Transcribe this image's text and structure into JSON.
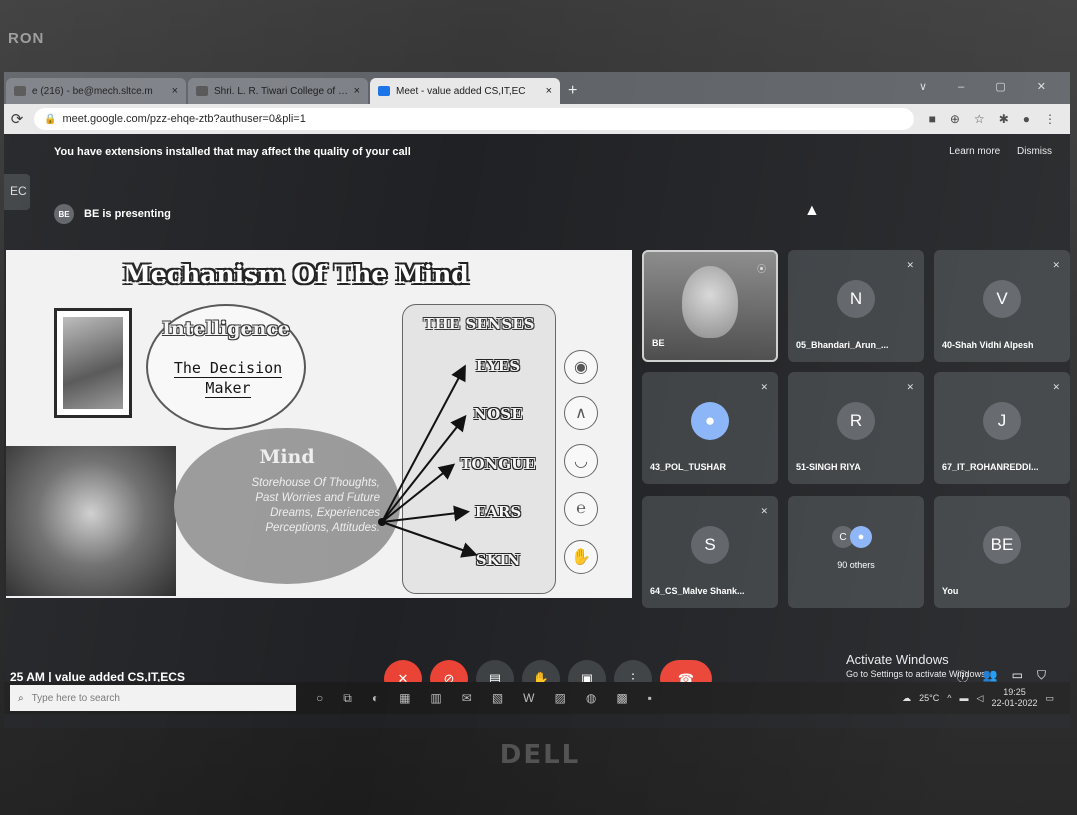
{
  "bezel": {
    "brand": "RON",
    "logo": "DELL"
  },
  "browser": {
    "tabs": [
      {
        "label": "e (216) - be@mech.sltce.m",
        "close": "×",
        "icon": "mail-icon"
      },
      {
        "label": "Shri. L. R. Tiwari College of Engin",
        "close": "×",
        "icon": "page-icon"
      },
      {
        "label": "Meet - value added CS,IT,EC",
        "close": "×",
        "icon": "meet-icon"
      }
    ],
    "new_tab": "+",
    "window_controls": "∨ – ▢ ✕",
    "url": "meet.google.com/pzz-ehqe-ztb?authuser=0&pli=1"
  },
  "meet": {
    "banner": {
      "text": "You have extensions installed that may affect the quality of your call",
      "learn_more": "Learn more",
      "dismiss": "Dismiss"
    },
    "side_tab": "EC",
    "presenting": {
      "avatar": "BE",
      "text": "BE is presenting"
    },
    "slide": {
      "title": "Mechanism Of The Mind",
      "intelligence": {
        "heading": "Intelligence",
        "line1": "The Decision",
        "line2": "Maker"
      },
      "mind": {
        "heading": "Mind",
        "line1": "Storehouse Of Thoughts,",
        "line2": "Past Worries and Future",
        "line3": "Dreams, Experiences",
        "line4": "Perceptions, Attitudes."
      },
      "senses_heading": "THE SENSES",
      "senses": [
        "EYES",
        "NOSE",
        "TONGUE",
        "EARS",
        "SKIN"
      ]
    },
    "participants": [
      {
        "name": "BE",
        "avatar": "",
        "video": true
      },
      {
        "name": "05_Bhandari_Arun_...",
        "avatar": "N",
        "color": "#5f6368"
      },
      {
        "name": "40-Shah Vidhi Alpesh",
        "avatar": "V",
        "color": "#5f6368"
      },
      {
        "name": "43_POL_TUSHAR",
        "avatar": "",
        "color": "#8ab4f8"
      },
      {
        "name": "51-SINGH RIYA",
        "avatar": "R",
        "color": "#5f6368"
      },
      {
        "name": "67_IT_ROHANREDDI...",
        "avatar": "J",
        "color": "#5f6368"
      },
      {
        "name": "64_CS_Malve Shank...",
        "avatar": "S",
        "color": "#5f6368"
      },
      {
        "name": "90 others",
        "avatar": "C",
        "color": "#5f6368"
      },
      {
        "name": "You",
        "avatar": "BE",
        "color": "#5f6368"
      }
    ],
    "bottom": {
      "info": "25 AM  |  value added CS,IT,ECS",
      "activate_title": "Activate Windows",
      "activate_sub": "Go to Settings to activate Windows."
    }
  },
  "taskbar": {
    "search_placeholder": "Type here to search",
    "weather": "25°C",
    "time": "19:25",
    "date": "22-01-2022"
  }
}
